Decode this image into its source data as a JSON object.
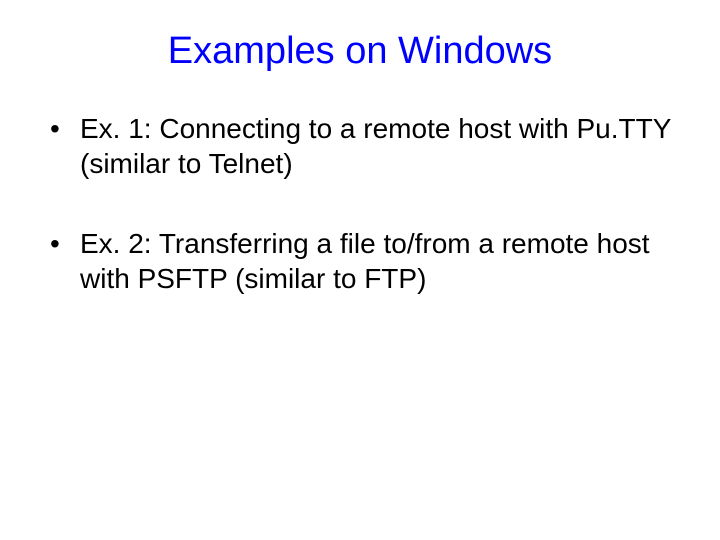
{
  "slide": {
    "title": "Examples on Windows",
    "bullets": [
      "Ex. 1: Connecting to a remote host with Pu.TTY (similar to Telnet)",
      "Ex. 2: Transferring a file to/from a remote host with PSFTP (similar to FTP)"
    ]
  }
}
